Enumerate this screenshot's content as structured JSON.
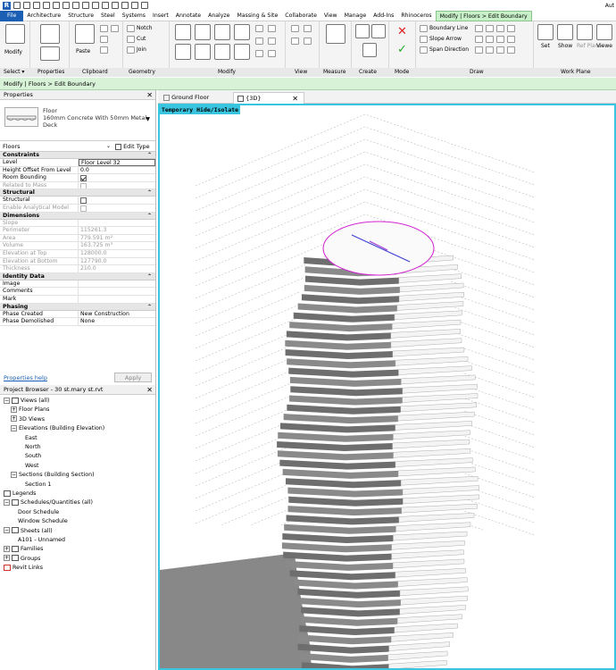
{
  "qat": {
    "app_letter": "R",
    "right_text": "Aut"
  },
  "menu": {
    "file": "File",
    "items": [
      "Architecture",
      "Structure",
      "Steel",
      "Systems",
      "Insert",
      "Annotate",
      "Analyze",
      "Massing & Site",
      "Collaborate",
      "View",
      "Manage",
      "Add-Ins",
      "Rhinoceros"
    ],
    "context_tab": "Modify | Floors > Edit Boundary"
  },
  "ribbon": {
    "select_label": "Select ▾",
    "properties_label": "Properties",
    "clipboard_label": "Clipboard",
    "geometry_label": "Geometry",
    "modify_label": "Modify",
    "view_label": "View",
    "measure_label": "Measure",
    "create_label": "Create",
    "mode_label": "Mode",
    "draw_label": "Draw",
    "workplane_label": "Work Plane",
    "modify_btn": "Modify",
    "paste_btn": "Paste",
    "notch": "Notch",
    "cut": "Cut",
    "join": "Join",
    "boundary_line": "Boundary Line",
    "slope_arrow": "Slope Arrow",
    "span_direction": "Span Direction",
    "set": "Set",
    "show": "Show",
    "ref_plane": "Ref Plane",
    "viewer": "Viewe"
  },
  "context_bar": "Modify | Floors > Edit Boundary",
  "properties": {
    "title": "Properties",
    "type_line1": "Floor",
    "type_line2": "160mm Concrete With 50mm Metal",
    "type_line3": "Deck",
    "instance": "Floors",
    "edit_type": "Edit Type",
    "sections": [
      {
        "name": "Constraints",
        "rows": [
          {
            "label": "Level",
            "value": "Floor Level 32",
            "kind": "input"
          },
          {
            "label": "Height Offset From Level",
            "value": "0.0",
            "kind": "text"
          },
          {
            "label": "Room Bounding",
            "value": "",
            "kind": "check_on"
          },
          {
            "label": "Related to Mass",
            "value": "",
            "kind": "check_dim"
          }
        ]
      },
      {
        "name": "Structural",
        "rows": [
          {
            "label": "Structural",
            "value": "",
            "kind": "check_off"
          },
          {
            "label": "Enable Analytical Model",
            "value": "",
            "kind": "check_dim"
          }
        ]
      },
      {
        "name": "Dimensions",
        "rows": [
          {
            "label": "Slope",
            "value": "",
            "kind": "dim"
          },
          {
            "label": "Perimeter",
            "value": "115261.3",
            "kind": "dim"
          },
          {
            "label": "Area",
            "value": "779.591 m²",
            "kind": "dim"
          },
          {
            "label": "Volume",
            "value": "163.725 m³",
            "kind": "dim"
          },
          {
            "label": "Elevation at Top",
            "value": "128000.0",
            "kind": "dim"
          },
          {
            "label": "Elevation at Bottom",
            "value": "127790.0",
            "kind": "dim"
          },
          {
            "label": "Thickness",
            "value": "210.0",
            "kind": "dim"
          }
        ]
      },
      {
        "name": "Identity Data",
        "rows": [
          {
            "label": "Image",
            "value": "",
            "kind": "text"
          },
          {
            "label": "Comments",
            "value": "",
            "kind": "text"
          },
          {
            "label": "Mark",
            "value": "",
            "kind": "text"
          }
        ]
      },
      {
        "name": "Phasing",
        "rows": [
          {
            "label": "Phase Created",
            "value": "New Construction",
            "kind": "text"
          },
          {
            "label": "Phase Demolished",
            "value": "None",
            "kind": "text"
          }
        ]
      }
    ],
    "help_link": "Properties help",
    "apply": "Apply"
  },
  "browser": {
    "title": "Project Browser - 30 st.mary st.rvt",
    "nodes": [
      {
        "label": "Views (all)",
        "level": 0,
        "toggle": "−",
        "icon": "views"
      },
      {
        "label": "Floor Plans",
        "level": 1,
        "toggle": "+",
        "icon": ""
      },
      {
        "label": "3D Views",
        "level": 1,
        "toggle": "+",
        "icon": ""
      },
      {
        "label": "Elevations (Building Elevation)",
        "level": 1,
        "toggle": "−",
        "icon": ""
      },
      {
        "label": "East",
        "level": 3,
        "toggle": "",
        "icon": ""
      },
      {
        "label": "North",
        "level": 3,
        "toggle": "",
        "icon": ""
      },
      {
        "label": "South",
        "level": 3,
        "toggle": "",
        "icon": ""
      },
      {
        "label": "West",
        "level": 3,
        "toggle": "",
        "icon": ""
      },
      {
        "label": "Sections (Building Section)",
        "level": 1,
        "toggle": "−",
        "icon": ""
      },
      {
        "label": "Section 1",
        "level": 3,
        "toggle": "",
        "icon": ""
      },
      {
        "label": "Legends",
        "level": 0,
        "toggle": "",
        "icon": "legend"
      },
      {
        "label": "Schedules/Quantities (all)",
        "level": 0,
        "toggle": "−",
        "icon": "schedule"
      },
      {
        "label": "Door Schedule",
        "level": 2,
        "toggle": "",
        "icon": ""
      },
      {
        "label": "Window Schedule",
        "level": 2,
        "toggle": "",
        "icon": ""
      },
      {
        "label": "Sheets (all)",
        "level": 0,
        "toggle": "−",
        "icon": "sheet"
      },
      {
        "label": "A101 - Unnamed",
        "level": 2,
        "toggle": "",
        "icon": ""
      },
      {
        "label": "Families",
        "level": 0,
        "toggle": "+",
        "icon": "family"
      },
      {
        "label": "Groups",
        "level": 0,
        "toggle": "+",
        "icon": "group"
      },
      {
        "label": "Revit Links",
        "level": 0,
        "toggle": "",
        "icon": "link"
      }
    ]
  },
  "tabs": {
    "ground": "Ground Floor",
    "three_d": "{3D}"
  },
  "viewport": {
    "badge": "Temporary Hide/Isolate",
    "sketch_color": "#d020d0",
    "frame_color": "#39c5e0"
  }
}
